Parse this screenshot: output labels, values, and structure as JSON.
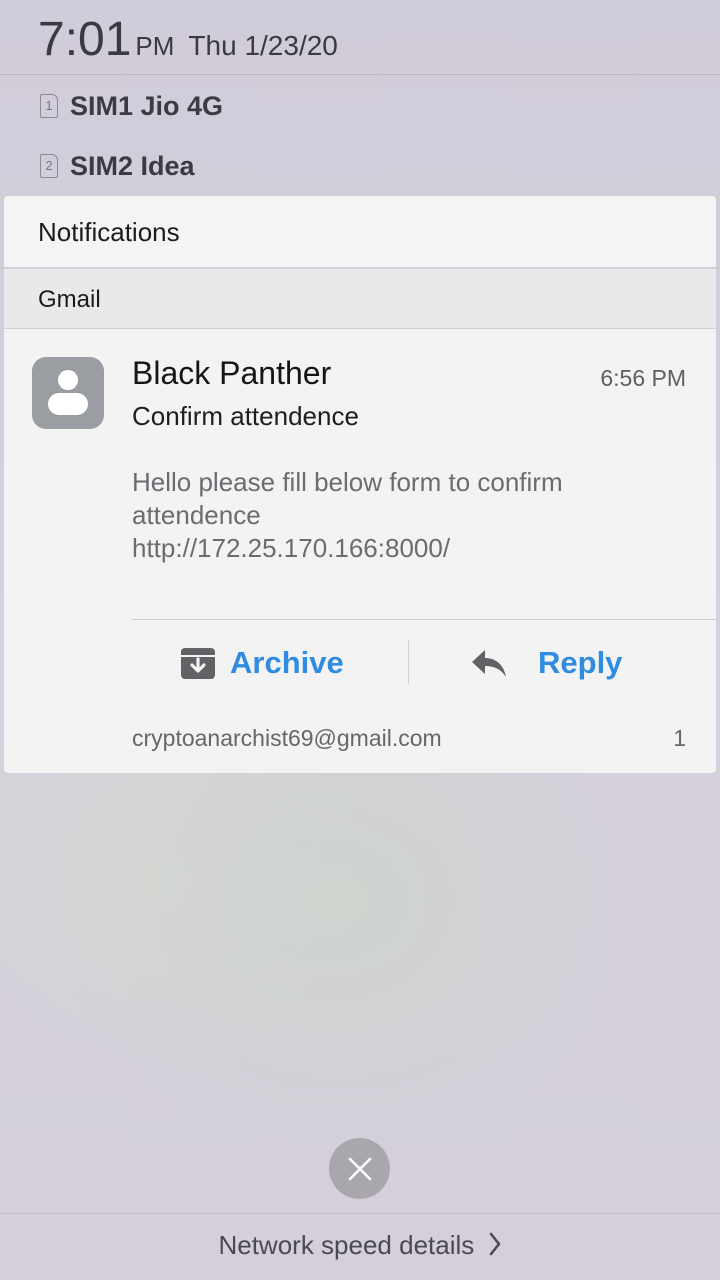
{
  "status": {
    "time": "7:01",
    "ampm": "PM",
    "date": "Thu 1/23/20"
  },
  "sims": [
    {
      "slot": "1",
      "label": "SIM1 Jio 4G"
    },
    {
      "slot": "2",
      "label": "SIM2 Idea"
    }
  ],
  "notifications": {
    "title": "Notifications",
    "app": "Gmail",
    "card": {
      "sender": "Black Panther",
      "time": "6:56 PM",
      "subject": "Confirm attendence",
      "body_lines": [
        "Hello please fill below form to confirm",
        "attendence",
        "http://172.25.170.166:8000/"
      ],
      "actions": {
        "archive": "Archive",
        "reply": "Reply"
      },
      "account": "cryptoanarchist69@gmail.com",
      "count": "1"
    }
  },
  "footer": {
    "network_label": "Network speed details"
  },
  "icons": {
    "avatar": "person-avatar-icon",
    "archive": "archive-icon",
    "reply": "reply-icon",
    "close": "close-icon",
    "chevron": "chevron-right-icon",
    "sim": "sim-card-icon"
  },
  "colors": {
    "accent": "#2f8ce0",
    "background": "#d3ced9",
    "card": "#f3f3f4"
  }
}
